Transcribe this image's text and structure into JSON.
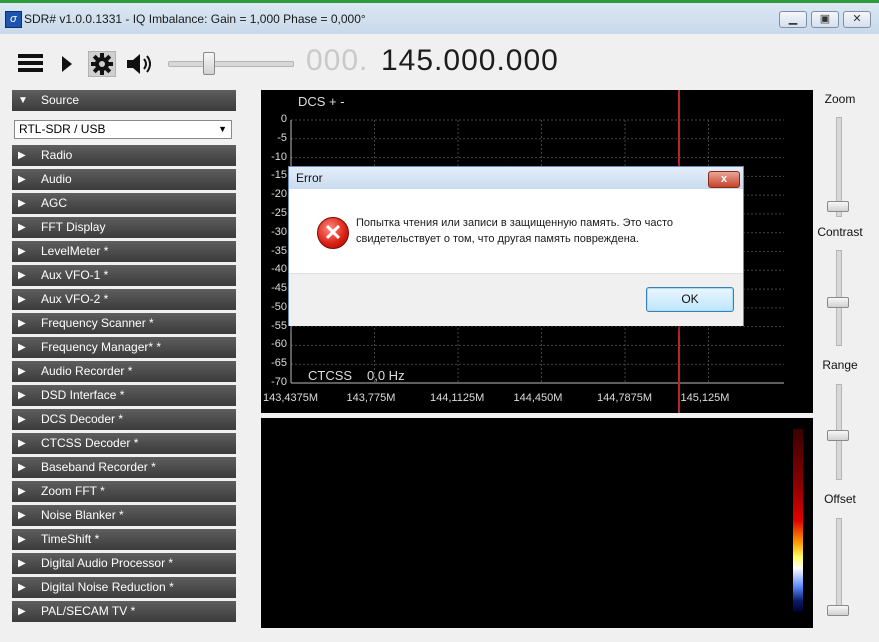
{
  "window": {
    "title": "SDR# v1.0.0.1331 - IQ Imbalance: Gain = 1,000 Phase = 0,000°",
    "app_icon": "sdrsharp-logo-icon",
    "buttons": [
      "minimize-icon",
      "maximize-icon",
      "close-icon"
    ]
  },
  "toolbar": {
    "icons": [
      "menu-icon",
      "play-icon",
      "gear-icon",
      "speaker-icon"
    ],
    "volume_level": 0.3,
    "frequency_prefix": "000.",
    "frequency_main": "145.000.000"
  },
  "sidebar": {
    "source_label": "Source",
    "source_selected": "RTL-SDR / USB",
    "items": [
      {
        "label": "Radio"
      },
      {
        "label": "Audio"
      },
      {
        "label": "AGC"
      },
      {
        "label": "FFT Display"
      },
      {
        "label": "LevelMeter *"
      },
      {
        "label": "Aux VFO-1 *"
      },
      {
        "label": "Aux VFO-2 *"
      },
      {
        "label": "Frequency Scanner *"
      },
      {
        "label": "Frequency Manager* *"
      },
      {
        "label": "Audio Recorder *"
      },
      {
        "label": "DSD Interface *"
      },
      {
        "label": "DCS Decoder *"
      },
      {
        "label": "CTCSS Decoder *"
      },
      {
        "label": "Baseband Recorder *"
      },
      {
        "label": "Zoom FFT *"
      },
      {
        "label": "Noise Blanker *"
      },
      {
        "label": "TimeShift *"
      },
      {
        "label": "Digital Audio Processor *"
      },
      {
        "label": "Digital Noise Reduction *"
      },
      {
        "label": "PAL/SECAM TV *"
      }
    ]
  },
  "spectrum": {
    "dcs_label": "DCS + -",
    "db_labels": [
      "0",
      "-5",
      "-10",
      "-15",
      "-20",
      "-25",
      "-30",
      "-35",
      "-40",
      "-45",
      "-50",
      "-55",
      "-60",
      "-65",
      "-70"
    ],
    "freq_labels": [
      "143,4375M",
      "143,775M",
      "144,1125M",
      "144,450M",
      "144,7875M",
      "145,125M"
    ],
    "ctcss_label": "CTCSS",
    "ctcss_value": "0,0 Hz"
  },
  "right_panel": {
    "zoom_label": "Zoom",
    "contrast_label": "Contrast",
    "range_label": "Range",
    "offset_label": "Offset"
  },
  "dialog": {
    "title": "Error",
    "icon": "error-icon",
    "message": "Попытка чтения или записи в защищенную память. Это часто свидетельствует о том, что другая память повреждена.",
    "ok_label": "OK",
    "close_symbol": "x"
  }
}
